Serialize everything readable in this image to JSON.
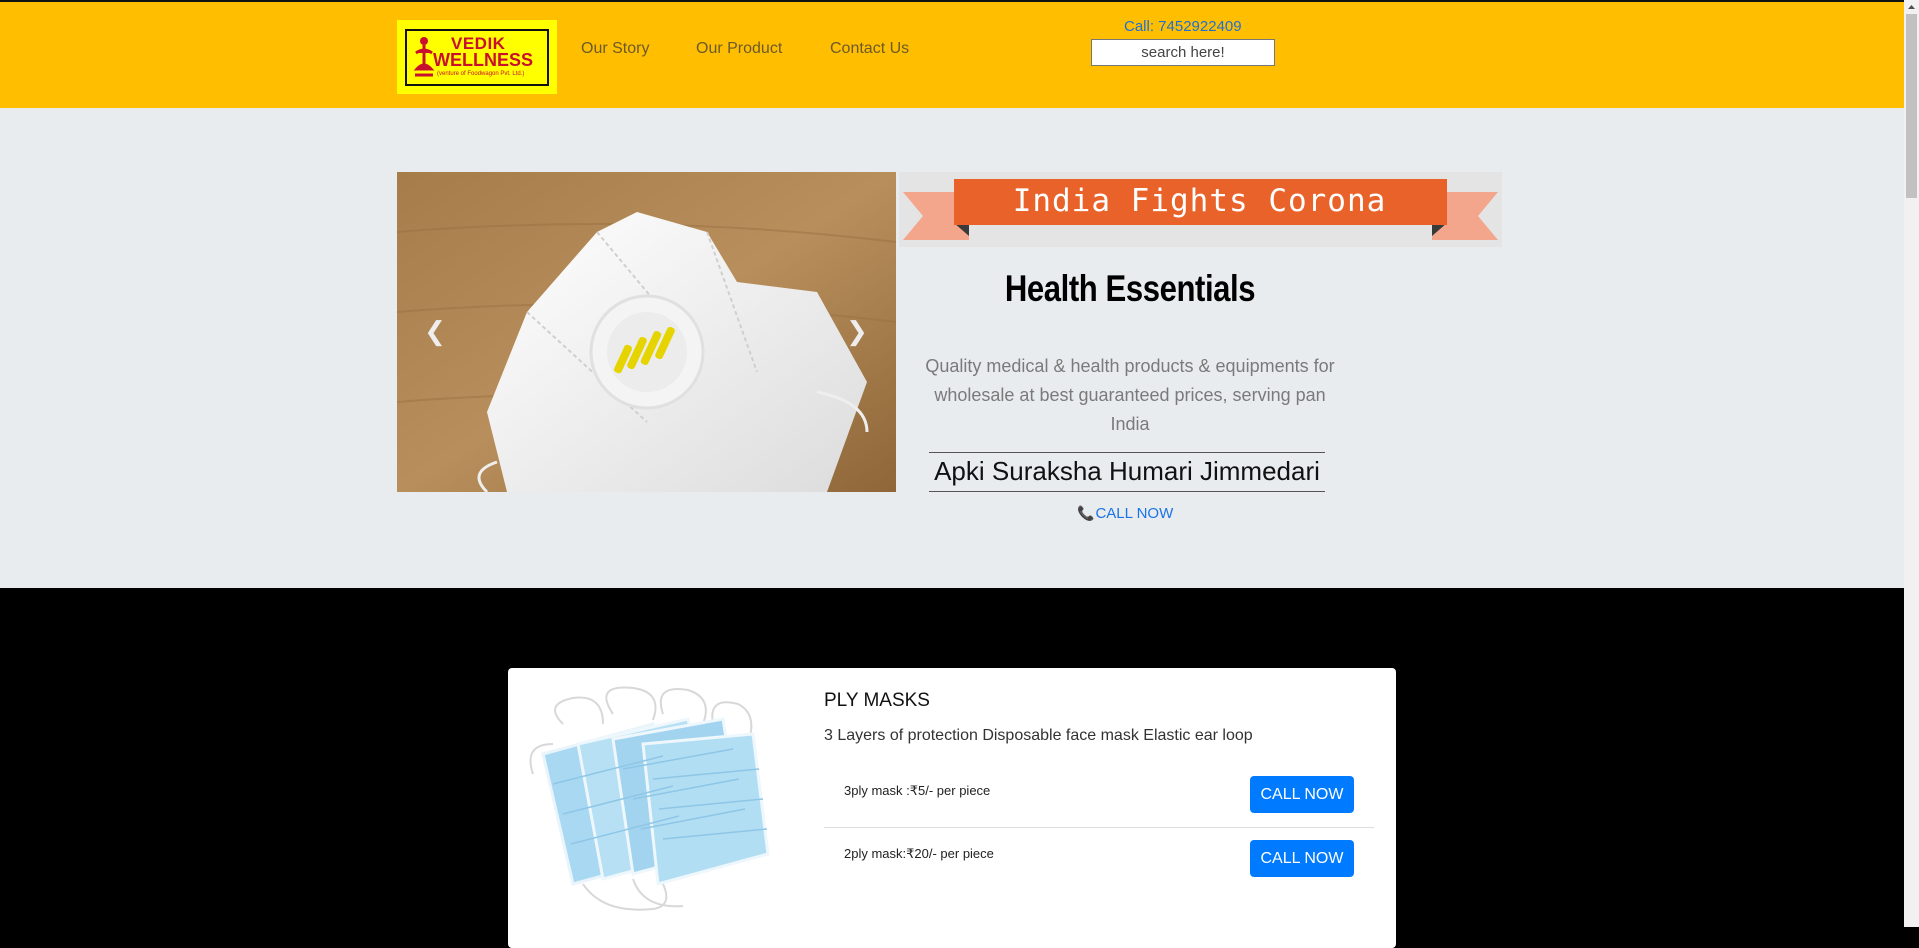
{
  "header": {
    "logo": {
      "line1": "VEDIK",
      "line2": "WELLNESS",
      "line3": "(venture of Foodwagon Pvt. Ltd.)"
    },
    "nav": [
      "Our Story",
      "Our Product",
      "Contact Us"
    ],
    "call": "Call: 7452922409",
    "search_placeholder": "search here!"
  },
  "hero": {
    "banner": "India Fights Corona",
    "title": "Health Essentials",
    "description": "Quality medical & health products & equipments for wholesale at best guaranteed prices, serving pan India",
    "tagline": "Apki Suraksha Humari Jimmedari",
    "call_now": "CALL NOW",
    "carousel": {
      "slides": 3,
      "active": 0
    }
  },
  "product": {
    "title": "PLY MASKS",
    "description": "3 Layers of protection Disposable face mask Elastic ear loop",
    "items": [
      {
        "label": "3ply mask :₹5/- per piece",
        "button": "CALL NOW"
      },
      {
        "label": "2ply mask:₹20/- per piece",
        "button": "CALL NOW"
      }
    ]
  },
  "colors": {
    "header_bg": "#ffbe00",
    "hero_bg": "#e9ecef",
    "banner_orange": "#e8622a",
    "button_blue": "#007bff",
    "link_blue": "#1a73e8"
  },
  "icons": {
    "prev": "chevron-left-icon",
    "next": "chevron-right-icon",
    "phone": "phone-icon"
  }
}
